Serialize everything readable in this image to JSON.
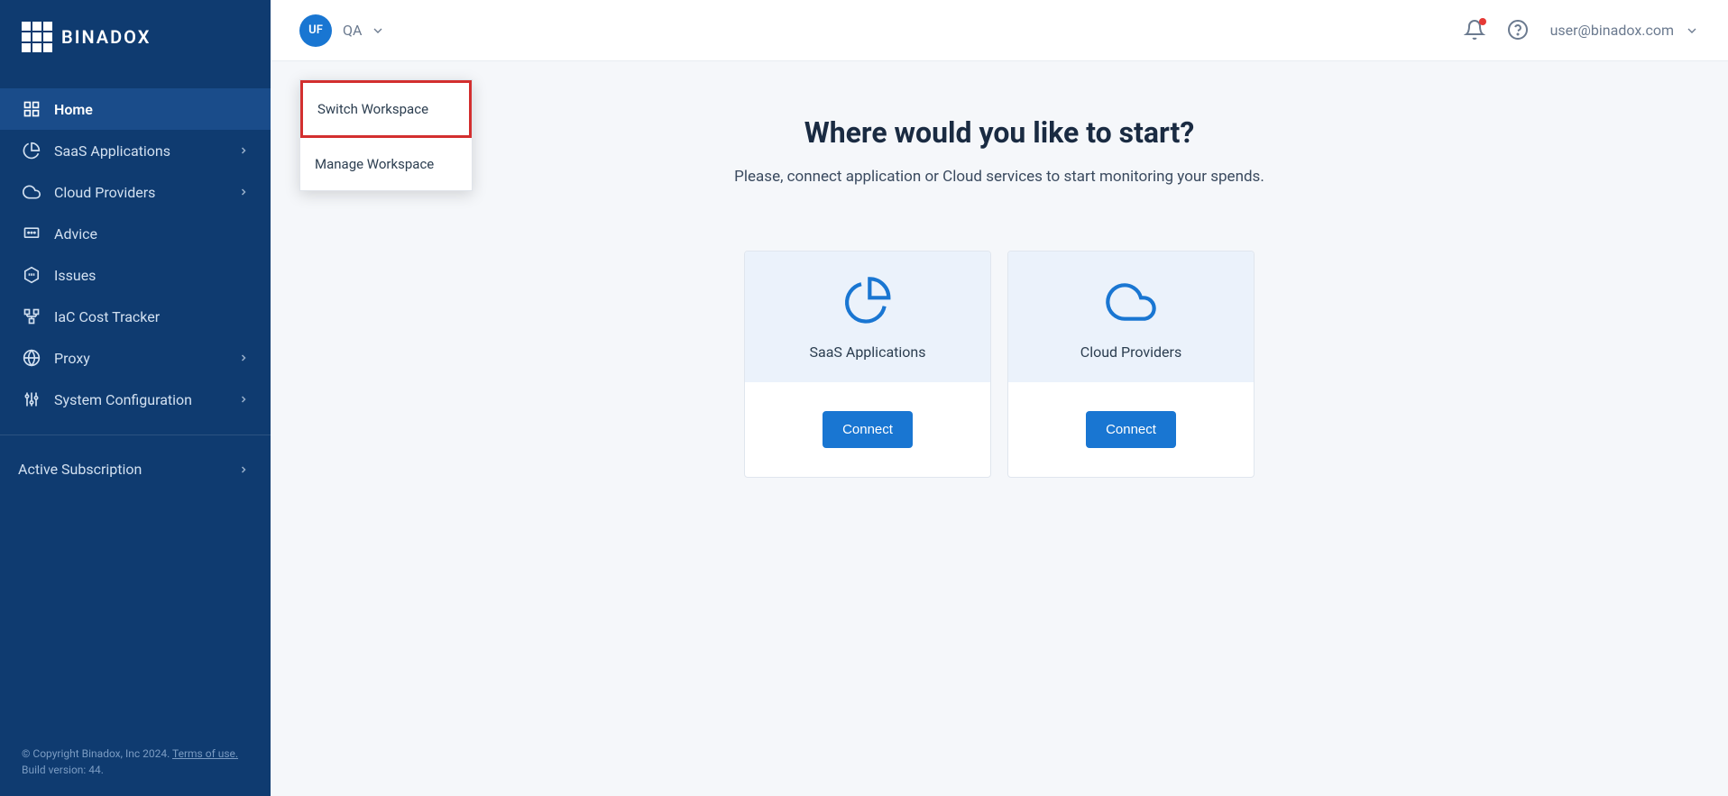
{
  "brand": {
    "name": "BINADOX"
  },
  "sidebar": {
    "items": [
      {
        "label": "Home",
        "active": true,
        "icon": "home",
        "chevron": false
      },
      {
        "label": "SaaS Applications",
        "active": false,
        "icon": "pie",
        "chevron": true
      },
      {
        "label": "Cloud Providers",
        "active": false,
        "icon": "cloud",
        "chevron": true
      },
      {
        "label": "Advice",
        "active": false,
        "icon": "chat",
        "chevron": false
      },
      {
        "label": "Issues",
        "active": false,
        "icon": "alert",
        "chevron": false
      },
      {
        "label": "IaC Cost Tracker",
        "active": false,
        "icon": "iac",
        "chevron": false
      },
      {
        "label": "Proxy",
        "active": false,
        "icon": "globe",
        "chevron": true
      },
      {
        "label": "System Configuration",
        "active": false,
        "icon": "sliders",
        "chevron": true
      }
    ],
    "subscription_label": "Active Subscription",
    "footer": {
      "copyright": "© Copyright Binadox, Inc 2024.",
      "terms_link": "Terms of use.",
      "build": "Build version: 44."
    }
  },
  "topbar": {
    "workspace_initials": "UF",
    "workspace_name": "QA",
    "user_email": "user@binadox.com",
    "dropdown": {
      "switch": "Switch Workspace",
      "manage": "Manage Workspace"
    }
  },
  "content": {
    "title": "Where would you like to start?",
    "subtitle": "Please, connect application or Cloud services to start monitoring your spends.",
    "cards": [
      {
        "title": "SaaS Applications",
        "icon": "pie",
        "button": "Connect"
      },
      {
        "title": "Cloud Providers",
        "icon": "cloud",
        "button": "Connect"
      }
    ]
  }
}
